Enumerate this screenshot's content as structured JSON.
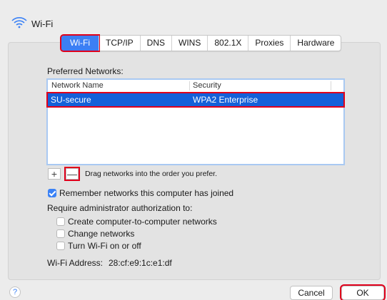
{
  "window": {
    "title": "Wi-Fi"
  },
  "tabs": [
    {
      "label": "Wi-Fi",
      "active": true
    },
    {
      "label": "TCP/IP"
    },
    {
      "label": "DNS"
    },
    {
      "label": "WINS"
    },
    {
      "label": "802.1X"
    },
    {
      "label": "Proxies"
    },
    {
      "label": "Hardware"
    }
  ],
  "preferred": {
    "label": "Preferred Networks:",
    "columns": [
      "Network Name",
      "Security"
    ],
    "rows": [
      {
        "name": "SU-secure",
        "security": "WPA2 Enterprise",
        "selected": true
      }
    ]
  },
  "list_controls": {
    "add": "+",
    "remove": "—",
    "hint": "Drag networks into the order you prefer."
  },
  "remember": {
    "label": "Remember networks this computer has joined",
    "checked": true
  },
  "admin": {
    "label": "Require administrator authorization to:",
    "options": [
      {
        "label": "Create computer-to-computer networks",
        "checked": false
      },
      {
        "label": "Change networks",
        "checked": false
      },
      {
        "label": "Turn Wi-Fi on or off",
        "checked": false
      }
    ]
  },
  "address": {
    "label": "Wi-Fi Address:",
    "value": "28:cf:e9:1c:e1:df"
  },
  "footer": {
    "help": "?",
    "cancel": "Cancel",
    "ok": "OK"
  },
  "colors": {
    "accent": "#3c7ff4",
    "selection": "#1460d9",
    "highlight": "#e0001b"
  }
}
